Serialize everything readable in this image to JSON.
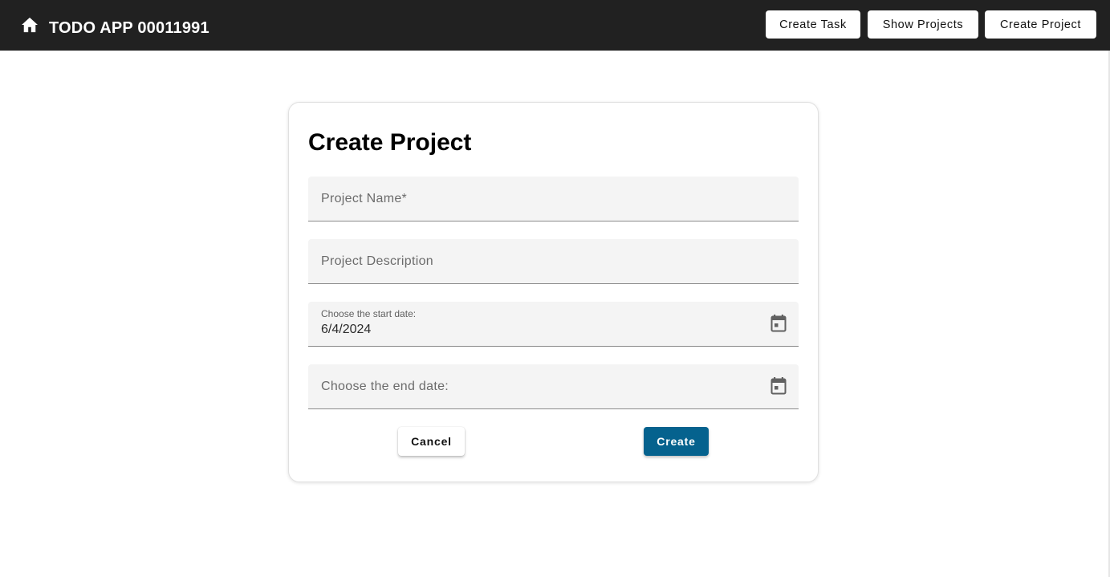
{
  "header": {
    "home_icon": "home-icon",
    "title": "TODO APP 00011991",
    "nav": {
      "create_task": "Create Task",
      "show_projects": "Show Projects",
      "create_project": "Create Project"
    }
  },
  "form": {
    "title": "Create Project",
    "project_name": {
      "placeholder": "Project Name*",
      "value": ""
    },
    "project_description": {
      "placeholder": "Project Description",
      "value": ""
    },
    "start_date": {
      "label": "Choose the start date:",
      "value": "6/4/2024",
      "icon": "calendar-icon"
    },
    "end_date": {
      "placeholder": "Choose the end date:",
      "value": "",
      "icon": "calendar-icon"
    },
    "cancel_label": "Cancel",
    "create_label": "Create"
  },
  "colors": {
    "toolbar": "#212121",
    "primary": "#05628e",
    "field_bg": "#f4f4f4"
  }
}
